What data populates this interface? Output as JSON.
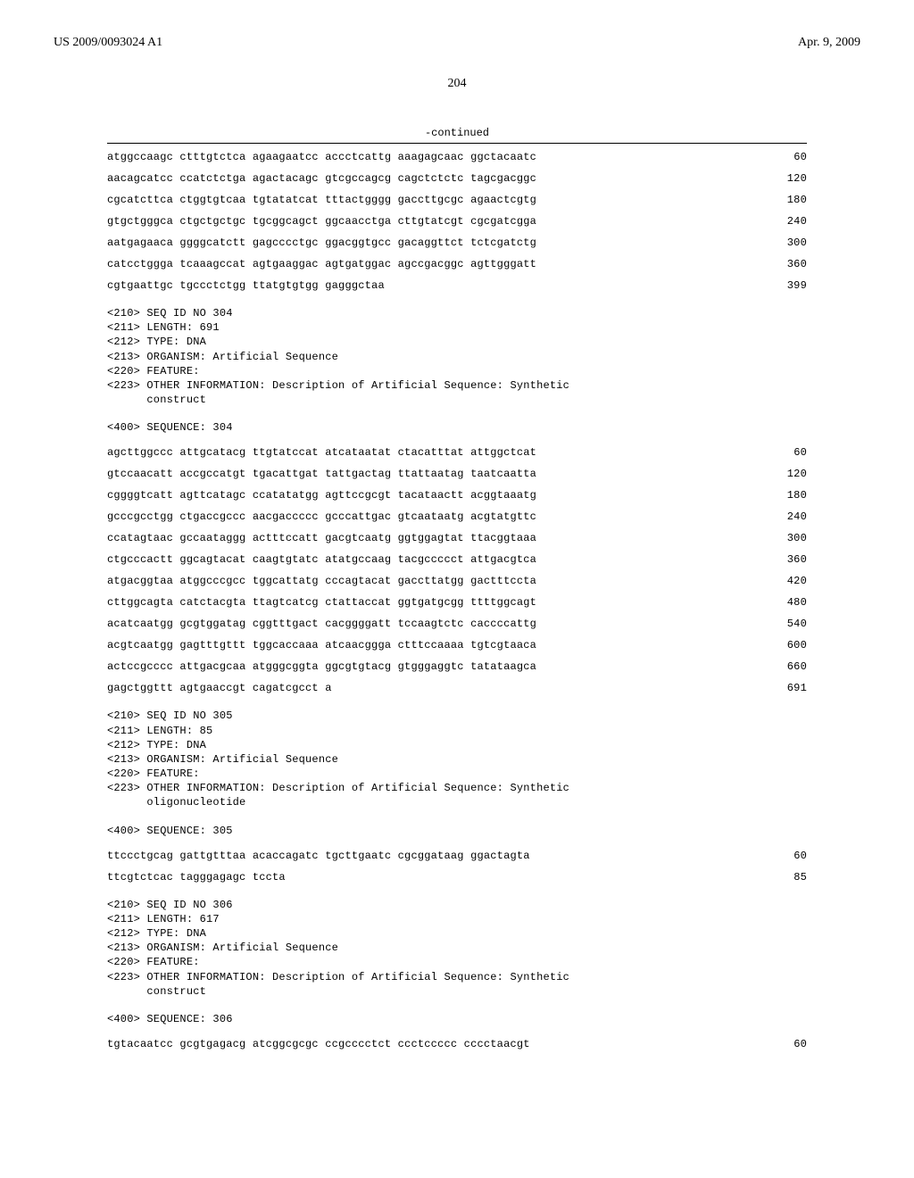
{
  "header": {
    "left": "US 2009/0093024 A1",
    "right": "Apr. 9, 2009"
  },
  "page_number": "204",
  "continued_label": "-continued",
  "block1": {
    "lines": [
      {
        "text": "atggccaagc ctttgtctca agaagaatcc accctcattg aaagagcaac ggctacaatc",
        "num": "60"
      },
      {
        "text": "aacagcatcc ccatctctga agactacagc gtcgccagcg cagctctctc tagcgacggc",
        "num": "120"
      },
      {
        "text": "cgcatcttca ctggtgtcaa tgtatatcat tttactgggg gaccttgcgc agaactcgtg",
        "num": "180"
      },
      {
        "text": "gtgctgggca ctgctgctgc tgcggcagct ggcaacctga cttgtatcgt cgcgatcgga",
        "num": "240"
      },
      {
        "text": "aatgagaaca ggggcatctt gagcccctgc ggacggtgcc gacaggttct tctcgatctg",
        "num": "300"
      },
      {
        "text": "catcctggga tcaaagccat agtgaaggac agtgatggac agccgacggc agttgggatt",
        "num": "360"
      },
      {
        "text": "cgtgaattgc tgccctctgg ttatgtgtgg gagggctaa",
        "num": "399"
      }
    ]
  },
  "meta304": "<210> SEQ ID NO 304\n<211> LENGTH: 691\n<212> TYPE: DNA\n<213> ORGANISM: Artificial Sequence\n<220> FEATURE:\n<223> OTHER INFORMATION: Description of Artificial Sequence: Synthetic\n      construct",
  "query304": "<400> SEQUENCE: 304",
  "block2": {
    "lines": [
      {
        "text": "agcttggccc attgcatacg ttgtatccat atcataatat ctacatttat attggctcat",
        "num": "60"
      },
      {
        "text": "gtccaacatt accgccatgt tgacattgat tattgactag ttattaatag taatcaatta",
        "num": "120"
      },
      {
        "text": "cggggtcatt agttcatagc ccatatatgg agttccgcgt tacataactt acggtaaatg",
        "num": "180"
      },
      {
        "text": "gcccgcctgg ctgaccgccc aacgaccccc gcccattgac gtcaataatg acgtatgttc",
        "num": "240"
      },
      {
        "text": "ccatagtaac gccaataggg actttccatt gacgtcaatg ggtggagtat ttacggtaaa",
        "num": "300"
      },
      {
        "text": "ctgcccactt ggcagtacat caagtgtatc atatgccaag tacgccccct attgacgtca",
        "num": "360"
      },
      {
        "text": "atgacggtaa atggcccgcc tggcattatg cccagtacat gaccttatgg gactttccta",
        "num": "420"
      },
      {
        "text": "cttggcagta catctacgta ttagtcatcg ctattaccat ggtgatgcgg ttttggcagt",
        "num": "480"
      },
      {
        "text": "acatcaatgg gcgtggatag cggtttgact cacggggatt tccaagtctc caccccattg",
        "num": "540"
      },
      {
        "text": "acgtcaatgg gagtttgttt tggcaccaaa atcaacggga ctttccaaaa tgtcgtaaca",
        "num": "600"
      },
      {
        "text": "actccgcccc attgacgcaa atgggcggta ggcgtgtacg gtgggaggtc tatataagca",
        "num": "660"
      },
      {
        "text": "gagctggttt agtgaaccgt cagatcgcct a",
        "num": "691"
      }
    ]
  },
  "meta305": "<210> SEQ ID NO 305\n<211> LENGTH: 85\n<212> TYPE: DNA\n<213> ORGANISM: Artificial Sequence\n<220> FEATURE:\n<223> OTHER INFORMATION: Description of Artificial Sequence: Synthetic\n      oligonucleotide",
  "query305": "<400> SEQUENCE: 305",
  "block3": {
    "lines": [
      {
        "text": "ttccctgcag gattgtttaa acaccagatc tgcttgaatc cgcggataag ggactagta",
        "num": "60"
      },
      {
        "text": "ttcgtctcac tagggagagc tccta",
        "num": "85"
      }
    ]
  },
  "meta306": "<210> SEQ ID NO 306\n<211> LENGTH: 617\n<212> TYPE: DNA\n<213> ORGANISM: Artificial Sequence\n<220> FEATURE:\n<223> OTHER INFORMATION: Description of Artificial Sequence: Synthetic\n      construct",
  "query306": "<400> SEQUENCE: 306",
  "block4": {
    "lines": [
      {
        "text": "tgtacaatcc gcgtgagacg atcggcgcgc ccgcccctct ccctccccc cccctaacgt",
        "num": "60"
      }
    ]
  }
}
